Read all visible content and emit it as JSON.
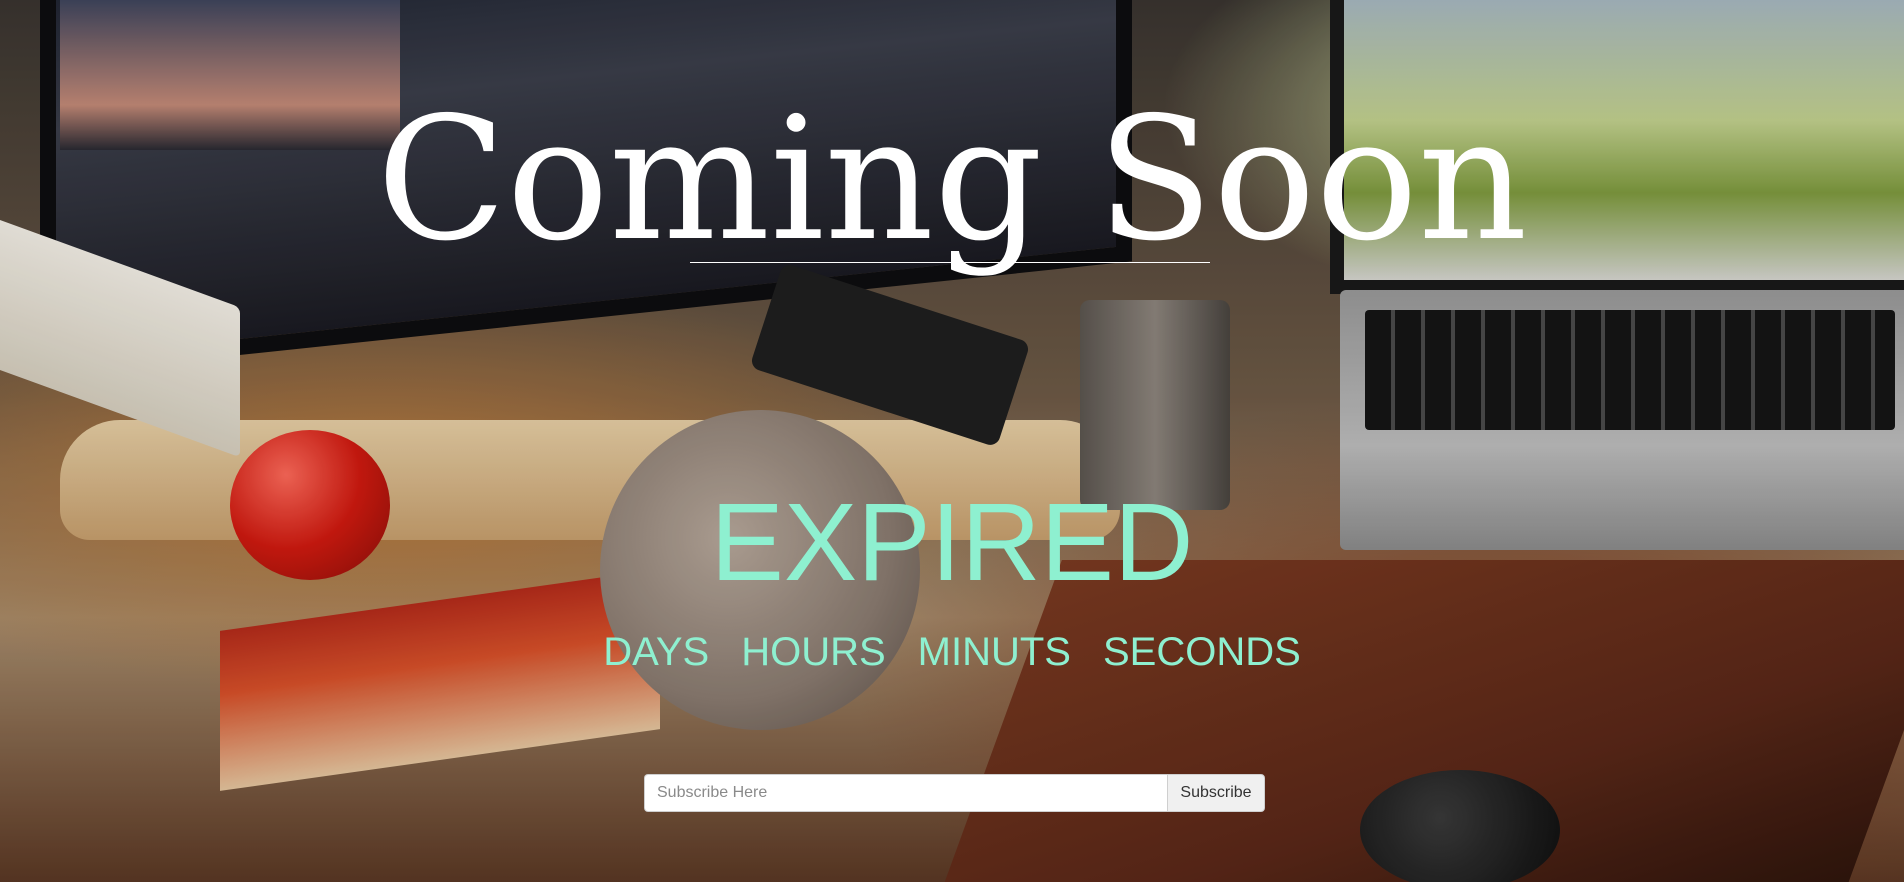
{
  "page": {
    "title": "Coming Soon",
    "countdown_status": "EXPIRED"
  },
  "countdown": {
    "units": [
      "DAYS",
      "HOURS",
      "MINUTS",
      "SECONDS"
    ]
  },
  "subscribe": {
    "placeholder": "Subscribe Here",
    "value": "",
    "button_label": "Subscribe"
  },
  "colors": {
    "title": "#ffffff",
    "accent": "#8ef0d0",
    "button_bg": "#f0f0f0"
  }
}
